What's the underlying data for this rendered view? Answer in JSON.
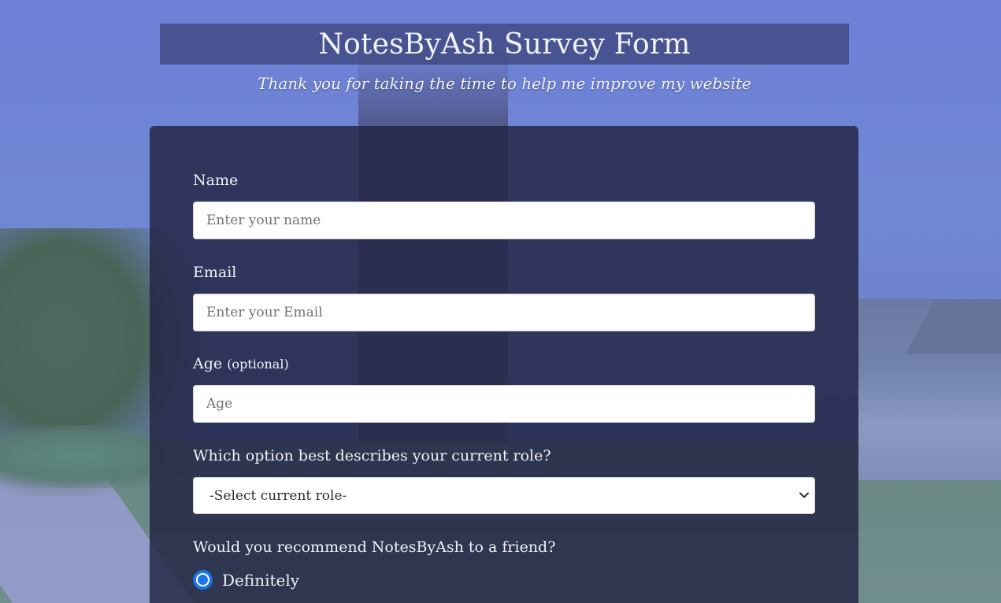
{
  "header": {
    "title": "NotesByAsh Survey Form",
    "subtitle": "Thank you for taking the time to help me improve my website"
  },
  "form": {
    "name": {
      "label": "Name",
      "placeholder": "Enter your name",
      "value": ""
    },
    "email": {
      "label": "Email",
      "placeholder": "Enter your Email",
      "value": ""
    },
    "age": {
      "label": "Age",
      "label_suffix": "(optional)",
      "placeholder": "Age",
      "value": ""
    },
    "role": {
      "label": "Which option best describes your current role?",
      "selected": "-Select current role-"
    },
    "recommend": {
      "question": "Would you recommend NotesByAsh to a friend?",
      "options": [
        {
          "label": "Definitely",
          "checked": true
        }
      ]
    }
  },
  "colors": {
    "accent": "#1a73e8",
    "panel": "#212342",
    "title_bar": "#28305a"
  },
  "icons": {
    "select_arrow": "chevron-down-icon"
  }
}
